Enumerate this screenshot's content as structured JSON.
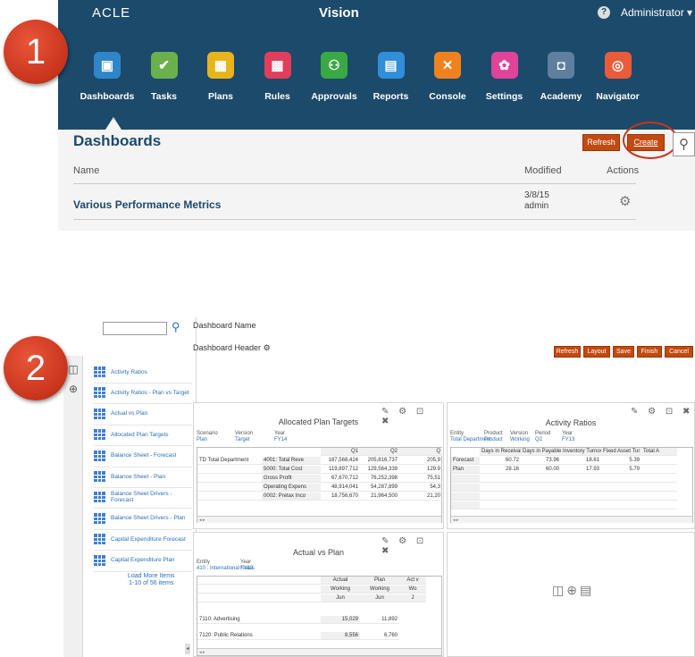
{
  "steps": [
    "1",
    "2"
  ],
  "panel1": {
    "brand": "ACLE",
    "app_title": "Vision",
    "help_glyph": "?",
    "user_menu": "Administrator ▾",
    "nav": [
      {
        "label": "Dashboards",
        "icon": "monitor-icon",
        "glyph": "▣",
        "color": "#2e86c9"
      },
      {
        "label": "Tasks",
        "icon": "checklist-icon",
        "glyph": "✔",
        "color": "#6ab04c"
      },
      {
        "label": "Plans",
        "icon": "grid-icon",
        "glyph": "▦",
        "color": "#e8b41c"
      },
      {
        "label": "Rules",
        "icon": "rules-icon",
        "glyph": "▩",
        "color": "#e23d5b"
      },
      {
        "label": "Approvals",
        "icon": "approvals-icon",
        "glyph": "⚇",
        "color": "#3aa845"
      },
      {
        "label": "Reports",
        "icon": "reports-icon",
        "glyph": "▤",
        "color": "#2f8fd8"
      },
      {
        "label": "Console",
        "icon": "tools-icon",
        "glyph": "✕",
        "color": "#f0821e"
      },
      {
        "label": "Settings",
        "icon": "settings-icon",
        "glyph": "✿",
        "color": "#e0439a"
      },
      {
        "label": "Academy",
        "icon": "academy-icon",
        "glyph": "◘",
        "color": "#5f7f9f"
      },
      {
        "label": "Navigator",
        "icon": "compass-icon",
        "glyph": "◎",
        "color": "#ea5b3a"
      }
    ],
    "page_title": "Dashboards",
    "refresh_label": "Refresh",
    "create_label": "Create",
    "columns": {
      "name": "Name",
      "modified": "Modified",
      "actions": "Actions"
    },
    "row": {
      "name": "Various Performance Metrics",
      "modified_date": "3/8/15",
      "modified_by": "admin"
    }
  },
  "panel2": {
    "library": [
      "Activity Ratios",
      "Activity Ratios - Plan vs Target",
      "Actual vs Plan",
      "Allocated Plan Targets",
      "Balance Sheet - Forecast",
      "Balance Sheet - Plan",
      "Balance Sheet Drivers - Forecast",
      "Balance Sheet Drivers - Plan",
      "Capital Expenditure Forecast",
      "Capital Expenditure Plan"
    ],
    "load_more": "Load More Items",
    "item_count": "1-10 of 56 items",
    "dashboard_name_label": "Dashboard Name",
    "dashboard_header_label": "Dashboard Header",
    "buttons": [
      "Refresh",
      "Layout",
      "Save",
      "Finish",
      "Cancel"
    ],
    "tile1": {
      "title": "Allocated Plan Targets",
      "pov": [
        {
          "label": "Scenario",
          "value": "Plan"
        },
        {
          "label": "Version",
          "value": "Target"
        },
        {
          "label": "Year",
          "value": "FY14"
        }
      ],
      "col_headers": [
        "Q1",
        "Q2",
        "Q"
      ],
      "rows": [
        {
          "entity": "TD Total Department",
          "account": "4001: Total Reve",
          "q1": "187,568,424",
          "q2": "205,816,737",
          "q3": "205,9"
        },
        {
          "entity": "",
          "account": "5000: Total Cost",
          "q1": "119,897,712",
          "q2": "129,564,339",
          "q3": "129.9"
        },
        {
          "entity": "",
          "account": "Gross Profit",
          "q1": "67,670,712",
          "q2": "76,252,398",
          "q3": "75,51"
        },
        {
          "entity": "",
          "account": "Operating Expens",
          "q1": "48,914,041",
          "q2": "54,287,899",
          "q3": "54,3"
        },
        {
          "entity": "",
          "account": "0002: Pretax Inco",
          "q1": "18,756,670",
          "q2": "21,964,500",
          "q3": "21,20"
        }
      ]
    },
    "tile2": {
      "title": "Activity Ratios",
      "pov": [
        {
          "label": "Entity",
          "value": "Total Department"
        },
        {
          "label": "Product",
          "value": "Product"
        },
        {
          "label": "Version",
          "value": "Working"
        },
        {
          "label": "Period",
          "value": "Q2"
        },
        {
          "label": "Year",
          "value": "FY13"
        }
      ],
      "col_headers": [
        "Days in Receival",
        "Days in Payable",
        "Inventory Turnov",
        "Fixed Asset Tur",
        "Total A"
      ],
      "rows": [
        {
          "label": "Forecast",
          "values": [
            "60.72",
            "73.96",
            "18.61",
            "5.39",
            ""
          ]
        },
        {
          "label": "Plan",
          "values": [
            "28.16",
            "60.00",
            "17.93",
            "5.79",
            ""
          ]
        }
      ]
    },
    "tile3": {
      "title": "Actual vs Plan",
      "pov": [
        {
          "label": "Entity",
          "value": "410 : International Sales"
        },
        {
          "label": "Year",
          "value": "FY13"
        }
      ],
      "col_headers": [
        {
          "l1": "Actual",
          "l2": "Working",
          "l3": "Jun"
        },
        {
          "l1": "Plan",
          "l2": "Working",
          "l3": "Jun"
        },
        {
          "l1": "Act v",
          "l2": "Wo",
          "l3": "J"
        }
      ],
      "rows": [
        {
          "label": "7110: Advertising",
          "actual": "15,029",
          "plan": "11,892"
        },
        {
          "label": "7120: Public Relations",
          "actual": "8,556",
          "plan": "6,760"
        }
      ]
    },
    "tile_tools": "✎ ⚙ ⊡ ✖"
  }
}
